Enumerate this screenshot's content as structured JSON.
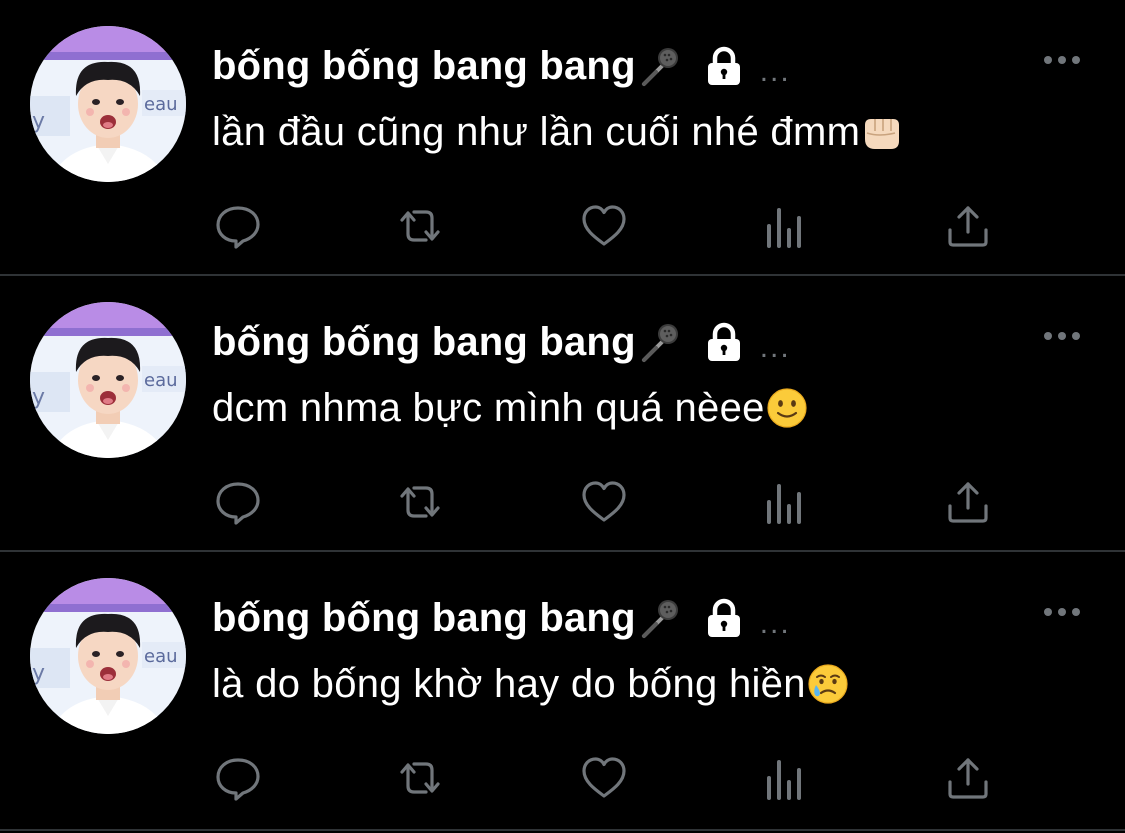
{
  "colors": {
    "background": "#000000",
    "text": "#ffffff",
    "secondary": "#71767b",
    "divider": "#2f3336"
  },
  "tweets": [
    {
      "display_name": "bống bống bang bang",
      "name_badges": [
        "microphone-icon",
        "lock-icon"
      ],
      "ellipsis": "...",
      "text": "lần đầu cũng như lần cuối nhé đmm",
      "emoji": "fist-icon",
      "actions": [
        "reply-icon",
        "retweet-icon",
        "like-icon",
        "views-icon",
        "share-icon"
      ]
    },
    {
      "display_name": "bống bống bang bang",
      "name_badges": [
        "microphone-icon",
        "lock-icon"
      ],
      "ellipsis": "...",
      "text": "dcm nhma bực mình quá nèee",
      "emoji": "slight-smile-icon",
      "actions": [
        "reply-icon",
        "retweet-icon",
        "like-icon",
        "views-icon",
        "share-icon"
      ]
    },
    {
      "display_name": "bống bống bang bang",
      "name_badges": [
        "microphone-icon",
        "lock-icon"
      ],
      "ellipsis": "...",
      "text": "là do bống khờ hay do bống hiền",
      "emoji": "crying-face-icon",
      "actions": [
        "reply-icon",
        "retweet-icon",
        "like-icon",
        "views-icon",
        "share-icon"
      ]
    }
  ]
}
